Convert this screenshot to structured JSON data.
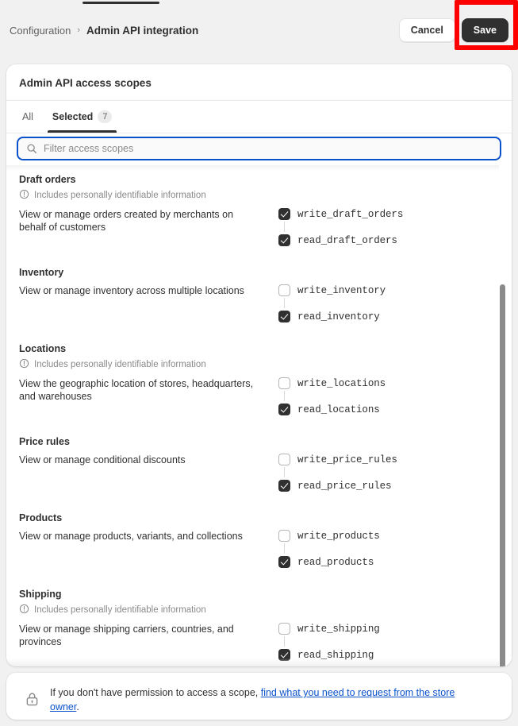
{
  "header": {
    "breadcrumb_parent": "Configuration",
    "breadcrumb_separator": "›",
    "breadcrumb_current": "Admin API integration",
    "cancel_label": "Cancel",
    "save_label": "Save"
  },
  "card": {
    "title": "Admin API access scopes",
    "tabs": [
      {
        "label": "All",
        "count": null,
        "active": false
      },
      {
        "label": "Selected",
        "count": "7",
        "active": true
      }
    ],
    "search": {
      "placeholder": "Filter access scopes",
      "value": "",
      "icon": "search-icon"
    }
  },
  "groups": [
    {
      "title": "Draft orders",
      "pii": "Includes personally identifiable information",
      "description": "View or manage orders created by merchants on behalf of customers",
      "scopes": [
        {
          "name": "write_draft_orders",
          "checked": true
        },
        {
          "name": "read_draft_orders",
          "checked": true
        }
      ]
    },
    {
      "title": "Inventory",
      "pii": null,
      "description": "View or manage inventory across multiple locations",
      "scopes": [
        {
          "name": "write_inventory",
          "checked": false
        },
        {
          "name": "read_inventory",
          "checked": true
        }
      ]
    },
    {
      "title": "Locations",
      "pii": "Includes personally identifiable information",
      "description": "View the geographic location of stores, headquarters, and warehouses",
      "scopes": [
        {
          "name": "write_locations",
          "checked": false
        },
        {
          "name": "read_locations",
          "checked": true
        }
      ]
    },
    {
      "title": "Price rules",
      "pii": null,
      "description": "View or manage conditional discounts",
      "scopes": [
        {
          "name": "write_price_rules",
          "checked": false
        },
        {
          "name": "read_price_rules",
          "checked": true
        }
      ]
    },
    {
      "title": "Products",
      "pii": null,
      "description": "View or manage products, variants, and collections",
      "scopes": [
        {
          "name": "write_products",
          "checked": false
        },
        {
          "name": "read_products",
          "checked": true
        }
      ]
    },
    {
      "title": "Shipping",
      "pii": "Includes personally identifiable information",
      "description": "View or manage shipping carriers, countries, and provinces",
      "scopes": [
        {
          "name": "write_shipping",
          "checked": false
        },
        {
          "name": "read_shipping",
          "checked": true
        }
      ]
    }
  ],
  "footer": {
    "icon": "lock-icon",
    "text_before": "If you don't have permission to access a scope, ",
    "link_text": "find what you need to request from the store owner",
    "text_after": "."
  },
  "colors": {
    "page_bg": "#f1f1f1",
    "card_bg": "#ffffff",
    "text_primary": "#303030",
    "text_secondary": "#616161",
    "text_muted": "#8a8a8a",
    "accent_link": "#0a52cc",
    "focus_border": "#0a52cc",
    "checkbox_on": "#303030",
    "annotation": "#ff0000",
    "scrollbar": "#8a8a8a"
  }
}
